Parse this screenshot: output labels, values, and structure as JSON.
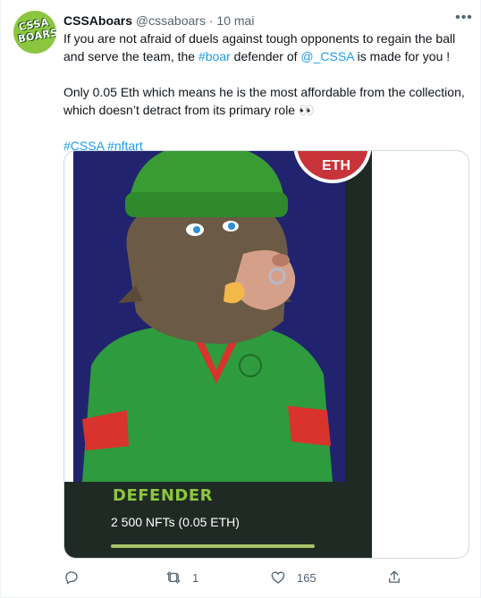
{
  "tweet": {
    "avatar_text": "CSSA BOARS",
    "display_name": "CSSAboars",
    "handle": "@cssaboars",
    "separator": "·",
    "date": "10 mai",
    "text": {
      "p1_a": "If you are not afraid of duels against tough opponents to regain the ball and serve the team, the ",
      "p1_hashtag": "#boar",
      "p1_b": " defender of ",
      "p1_mention": "@_CSSA",
      "p1_c": " is made for you !",
      "p2": "Only 0.05 Eth which means he is the most affordable from the collection, which doesn’t detract from its primary role 👀",
      "hashtag1": "#CSSA",
      "hashtag2": "#nftart"
    },
    "media": {
      "badge": "ETH",
      "title": "DEFENDER",
      "subtitle": "2 500 NFTs (0.05 ETH)"
    },
    "actions": {
      "replies": "",
      "retweets": "1",
      "likes": "165"
    },
    "colors": {
      "link": "#1d9bf0",
      "secondary_text": "#536471",
      "card_dark": "#1f2a24",
      "title_green": "#8dc63f",
      "badge_red": "#c8333a",
      "art_background": "#21236e"
    }
  }
}
